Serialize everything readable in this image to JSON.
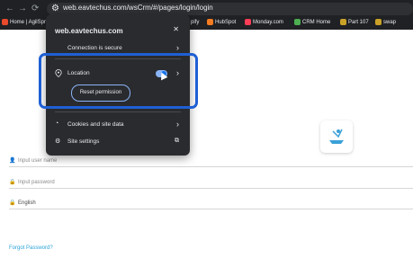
{
  "browser": {
    "url": "web.eavtechus.com/wsCrm/#/pages/login/login",
    "bookmarks": [
      {
        "label": "Home | AgilSpro"
      },
      {
        "label": "pify"
      },
      {
        "label": "HubSpot"
      },
      {
        "label": "Monday.com"
      },
      {
        "label": "CRM Home"
      },
      {
        "label": "Part 107"
      },
      {
        "label": "swap"
      }
    ]
  },
  "popup": {
    "site": "web.eavtechus.com",
    "connection": "Connection is secure",
    "location_label": "Location",
    "reset_label": "Reset permission",
    "cookies_label": "Cookies and site data",
    "settings_label": "Site settings",
    "location_enabled": true
  },
  "login": {
    "username_placeholder": "Input user name",
    "password_placeholder": "Input password",
    "language": "English",
    "forgot_label": "Forgot Password?"
  },
  "colors": {
    "accent": "#1f5fd4",
    "link": "#2aa3d8"
  }
}
